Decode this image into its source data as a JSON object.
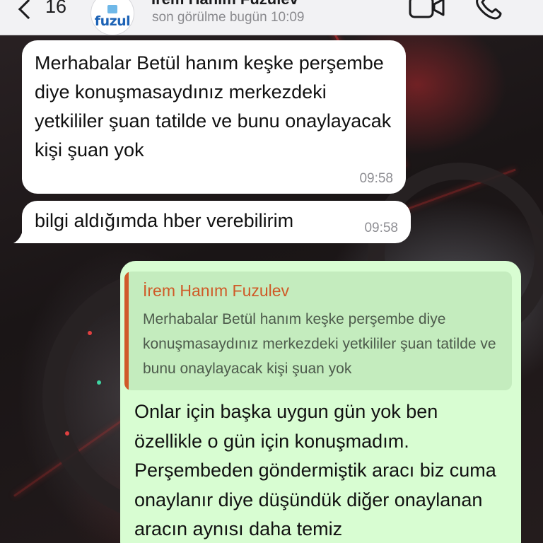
{
  "header": {
    "back_count": "16",
    "contact_name": "İrem Hanım Fuzulev",
    "last_seen": "son görülme bugün 10:09",
    "avatar_logo_text": "fuzul",
    "icons": [
      "chevron-left-icon",
      "video-icon",
      "phone-icon"
    ]
  },
  "messages": [
    {
      "direction": "incoming",
      "text": "Merhabalar Betül hanım keşke perşembe diye konuşmasaydınız merkezdeki yetkililer şuan tatilde ve bunu onaylayacak kişi şuan yok",
      "time": "09:58"
    },
    {
      "direction": "incoming",
      "text": "bilgi aldığımda hber verebilirim",
      "time": "09:58"
    },
    {
      "direction": "outgoing",
      "quote": {
        "author": "İrem Hanım Fuzulev",
        "text": "Merhabalar Betül hanım keşke perşembe diye konuşmasaydınız merkezdeki yetkililer şuan tatilde ve bunu onaylayacak kişi şuan yok"
      },
      "text": "Onlar için başka uygun gün yok ben özellikle o gün için konuşmadım. Perşembeden göndermiştik aracı biz cuma onaylanır diye düşündük diğer onaylanan aracın aynısı daha temiz"
    }
  ],
  "colors": {
    "header_bg": "#f2f2f4",
    "incoming_bubble": "#ffffff",
    "outgoing_bubble": "#d8fdd2",
    "quote_bg": "#c4ecbe",
    "quote_accent": "#d05a2a"
  }
}
